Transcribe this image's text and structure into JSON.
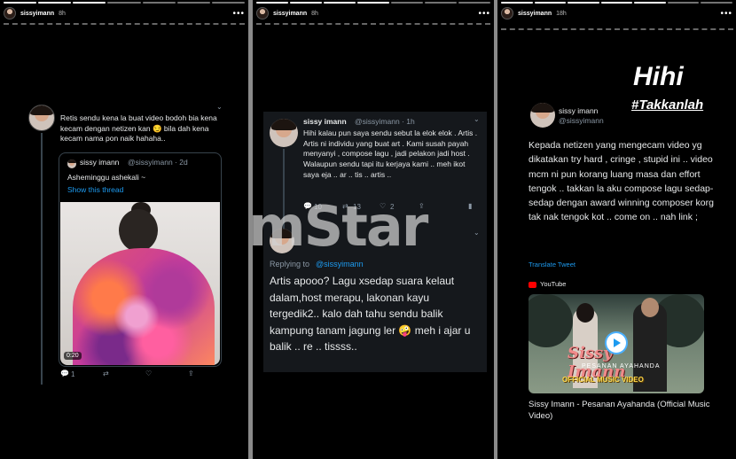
{
  "stories": [
    {
      "username": "sissyimann",
      "time": "8h"
    },
    {
      "username": "sissyimann",
      "time": "8h"
    },
    {
      "username": "sissyimann",
      "time": "18h"
    }
  ],
  "story1": {
    "tweet_text": "Retis sendu kena la buat video bodoh bia kena kecam dengan netizen kan 😏 bila dah kena kecam nama pon naik hahaha..",
    "quote": {
      "name": "sissy imann",
      "handle": "@sissyimann · 2d",
      "text": "Asheminggu ashekali ~",
      "show_thread": "Show this thread",
      "video_time": "0:20"
    },
    "actions": {
      "reply_count": "1"
    }
  },
  "story2": {
    "name": "sissy imann",
    "handle": "@sissyimann · 1h",
    "text": "Hihi kalau pun saya sendu sebut la elok elok . Artis . Artis ni individu yang buat art . Kami susah payah menyanyi , compose lagu , jadi pelakon jadi host . Walaupun sendu tapi itu kerjaya kami .. meh ikot saya eja .. ar .. tis .. artis ..",
    "actions": {
      "reply_count": "10",
      "retweet_count": "13",
      "like_count": "2"
    },
    "reply_to_label": "Replying to",
    "reply_to_handle": "@sissyimann",
    "reply_text": "Artis apooo? Lagu xsedap suara kelaut dalam,host merapu, lakonan kayu tergedik2.. kalo dah tahu sendu balik kampung tanam jagung ler 🤪 meh i ajar u balik .. re .. tissss.."
  },
  "watermark": "mStar",
  "story3": {
    "sticker_title": "Hihi",
    "sticker_hashtag": "#Takkanlah",
    "name": "sissy imann",
    "handle": "@sissyimann",
    "text": "Kepada netizen yang mengecam video yg dikatakan try hard , cringe , stupid ini .. video mcm ni pun korang luang masa dan effort tengok .. takkan la aku compose lagu sedap-sedap dengan award winning composer korg tak nak tengok kot .. come on .. nah link ;",
    "translate": "Translate Tweet",
    "youtube": {
      "source": "YouTube",
      "thumb_title": "Sissy Imann",
      "thumb_subtitle": "PESANAN AYAHANDA",
      "thumb_tag": "OFFICIAL MUSIC VIDEO",
      "title": "Sissy Imann - Pesanan Ayahanda (Official Music Video)"
    }
  },
  "colors": {
    "accent_blue": "#1d9bf0",
    "watermark": "#d2d2d2",
    "youtube_red": "#ff0000"
  }
}
